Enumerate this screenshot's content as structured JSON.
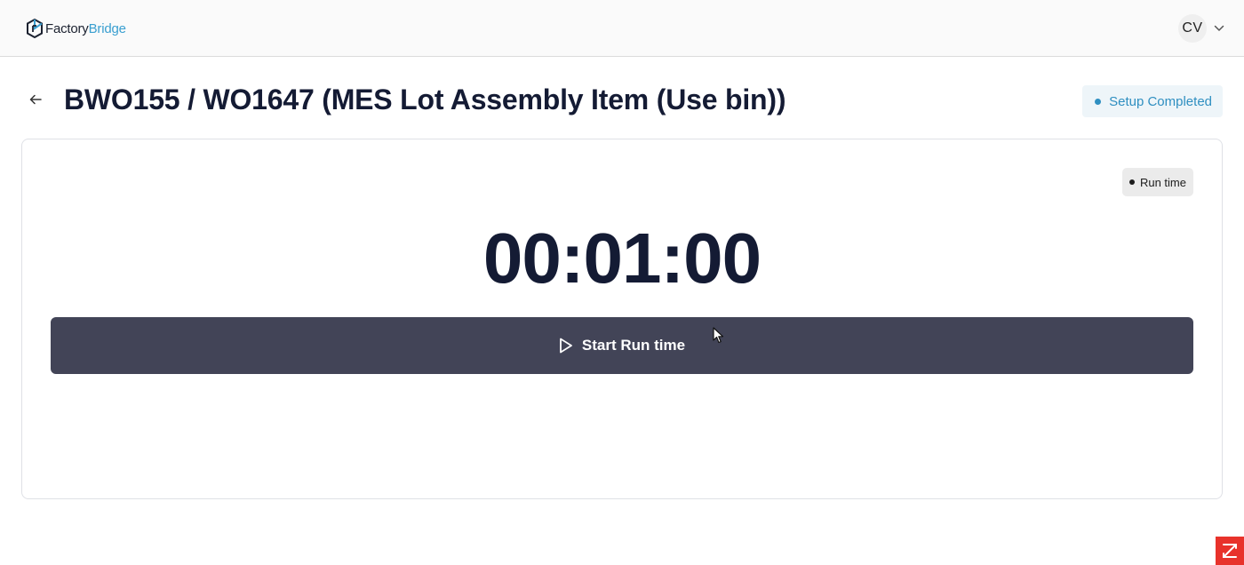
{
  "header": {
    "logo_part1": "Factory",
    "logo_part2": "Bridge",
    "user_initials": "CV"
  },
  "page": {
    "title": "BWO155 / WO1647 (MES Lot Assembly Item (Use bin))",
    "status": "Setup Completed"
  },
  "timer": {
    "mode_label": "Run time",
    "value": "00:01:00",
    "start_label": "Start Run time"
  },
  "colors": {
    "brand_blue": "#3a9fd0",
    "status_blue": "#2f8fc1",
    "button_bg": "#424457",
    "text_dark": "#141b34",
    "corner_red": "#e8322b"
  },
  "icons": {
    "logo": "factorybridge-logo-icon",
    "user_menu": "chevron-down-icon",
    "back": "arrow-left-icon",
    "start": "play-icon",
    "corner": "external-widget-icon"
  }
}
